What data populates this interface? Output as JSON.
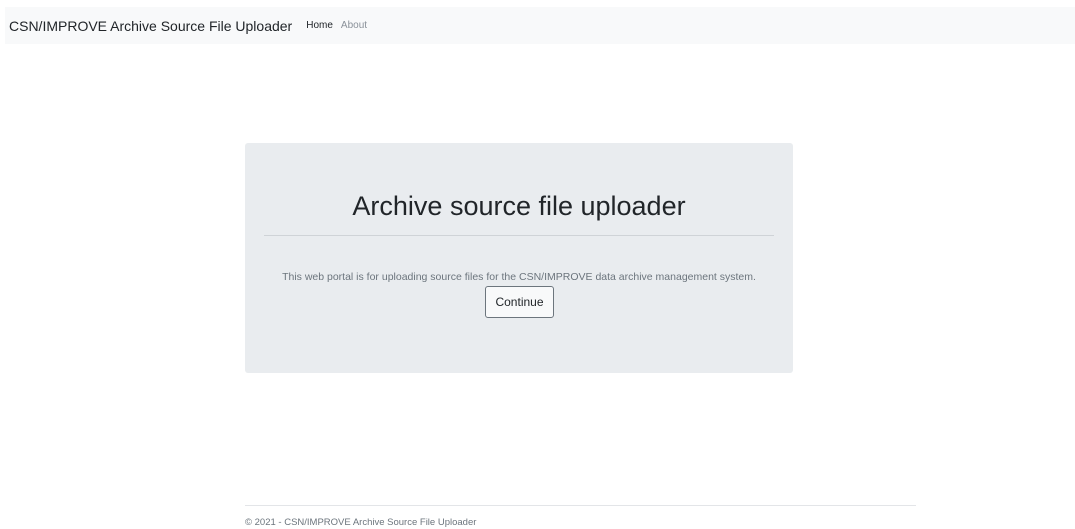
{
  "navbar": {
    "brand": "CSN/IMPROVE Archive Source File Uploader",
    "links": [
      {
        "label": "Home"
      },
      {
        "label": "About"
      }
    ]
  },
  "main": {
    "title": "Archive source file uploader",
    "description": "This web portal is for uploading source files for the CSN/IMPROVE data archive management system.",
    "continue_label": "Continue"
  },
  "footer": {
    "text": "© 2021 - CSN/IMPROVE Archive Source File Uploader"
  },
  "colors": {
    "navbar_bg": "#f8f9fa",
    "jumbotron_bg": "#e9ecef",
    "muted_text": "#6c757d"
  }
}
